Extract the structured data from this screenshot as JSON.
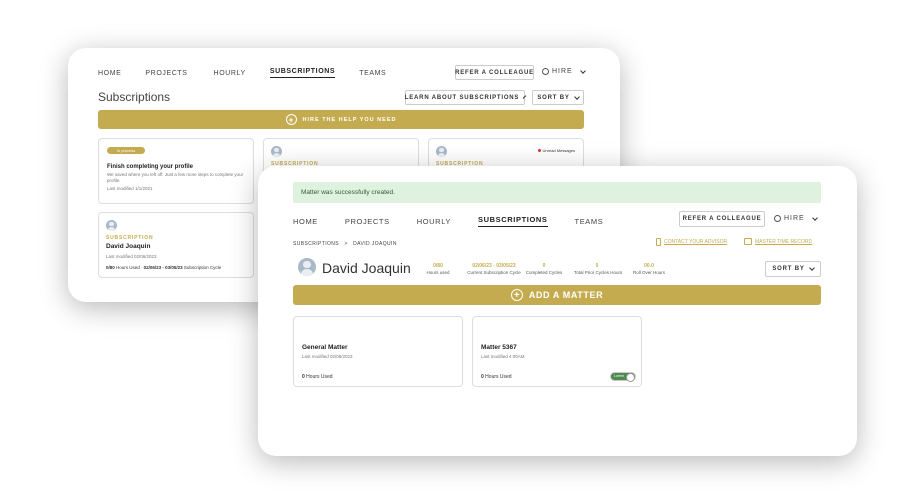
{
  "back": {
    "nav": [
      "HOME",
      "PROJECTS",
      "HOURLY",
      "SUBSCRIPTIONS",
      "TEAMS"
    ],
    "active_nav": "SUBSCRIPTIONS",
    "refer_label": "REFER A COLLEAGUE",
    "hire_label": "HIRE",
    "page_title": "Subscriptions",
    "learn_label": "LEARN ABOUT SUBSCRIPTIONS",
    "sort_label": "SORT BY",
    "hire_bar_label": "HIRE THE HELP YOU NEED",
    "profile_tile": {
      "badge": "In process",
      "title": "Finish completing your profile",
      "body": "We saved where you left off. Just a few more steps to complete your profile.",
      "meta": "Last modified 1/1/2021"
    },
    "sub_tile_2": {
      "label": "SUBSCRIPTION"
    },
    "sub_tile_3": {
      "label": "SUBSCRIPTION",
      "unread": "Unread Messages"
    },
    "david_tile": {
      "label": "SUBSCRIPTION",
      "name": "David Joaquin",
      "meta": "Last modified 02/06/2023",
      "hours_used": "0/80",
      "hours_suffix": "Hours Used",
      "cycle": "02/06/23 - 03/05/23",
      "cycle_suffix": "Subscription Cycle"
    }
  },
  "front": {
    "alert": "Matter was successfully created.",
    "nav": [
      "HOME",
      "PROJECTS",
      "HOURLY",
      "SUBSCRIPTIONS",
      "TEAMS"
    ],
    "active_nav": "SUBSCRIPTIONS",
    "refer_label": "REFER A COLLEAGUE",
    "hire_label": "HIRE",
    "breadcrumb_root": "SUBSCRIPTIONS",
    "breadcrumb_sep": ">",
    "breadcrumb_current": "DAVID JOAQUIN",
    "contact_link": "CONTACT YOUR ADVISOR",
    "master_link": "MASTER TIME RECORD",
    "client_name": "David Joaquin",
    "stats": [
      {
        "value": "0/80",
        "label": "Hours used"
      },
      {
        "value": "02/06/23 - 03/05/23",
        "label": "Current Subscription Cycle"
      },
      {
        "value": "0",
        "label": "Completed Cycles"
      },
      {
        "value": "0",
        "label": "Total Prior Cycles Hours"
      },
      {
        "value": "00.0",
        "label": "Roll Over Hours"
      }
    ],
    "sort_label": "SORT BY",
    "add_matter_label": "ADD A MATTER",
    "matters": [
      {
        "title": "General Matter",
        "meta": "Last modified 02/06/2023",
        "hours": "0",
        "hours_suffix": "Hours Used"
      },
      {
        "title": "Matter 5367",
        "meta": "Last modified 4:00AM",
        "hours": "0",
        "hours_suffix": "Hours Used",
        "toggle": "Lorem"
      }
    ]
  },
  "colors": {
    "accent": "#c4ab4f",
    "alert_bg": "#dff1df",
    "toggle_on": "#4f8a4f"
  }
}
